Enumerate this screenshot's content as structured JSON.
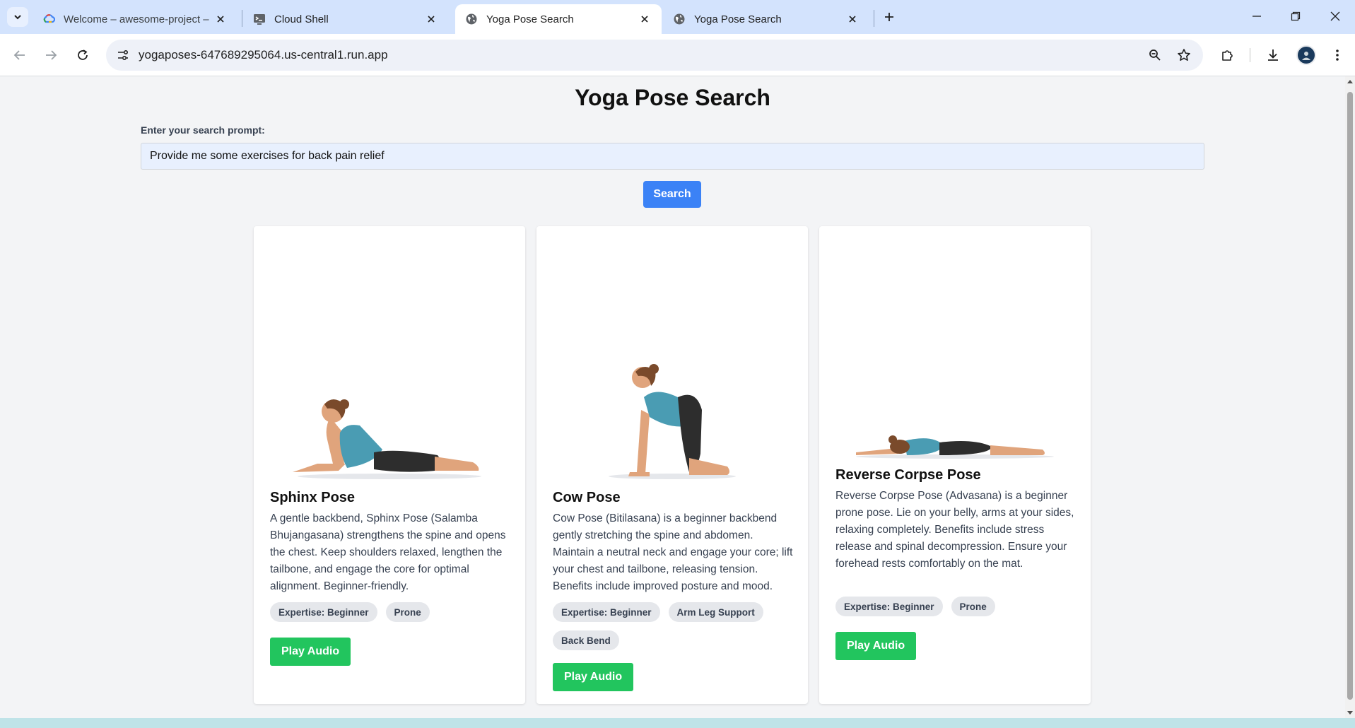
{
  "browser": {
    "tabs": [
      {
        "title": "Welcome – awesome-project –",
        "icon": "google-cloud-icon",
        "active": false
      },
      {
        "title": "Cloud Shell",
        "icon": "cloud-shell-icon",
        "active": false
      },
      {
        "title": "Yoga Pose Search",
        "icon": "globe-icon",
        "active": true
      },
      {
        "title": "Yoga Pose Search",
        "icon": "globe-icon",
        "active": false
      }
    ],
    "url": "yogaposes-647689295064.us-central1.run.app"
  },
  "page": {
    "title": "Yoga Pose Search",
    "search": {
      "label": "Enter your search prompt:",
      "value": "Provide me some exercises for back pain relief",
      "button_label": "Search"
    },
    "cards": [
      {
        "title": "Sphinx Pose",
        "description": "A gentle backbend, Sphinx Pose (Salamba Bhujangasana) strengthens the spine and opens the chest. Keep shoulders relaxed, lengthen the tailbone, and engage the core for optimal alignment. Beginner-friendly.",
        "tags": [
          "Expertise: Beginner",
          "Prone"
        ],
        "button_label": "Play Audio"
      },
      {
        "title": "Cow Pose",
        "description": "Cow Pose (Bitilasana) is a beginner backbend gently stretching the spine and abdomen. Maintain a neutral neck and engage your core; lift your chest and tailbone, releasing tension. Benefits include improved posture and mood.",
        "tags": [
          "Expertise: Beginner",
          "Arm Leg Support",
          "Back Bend"
        ],
        "button_label": "Play Audio"
      },
      {
        "title": "Reverse Corpse Pose",
        "description": "Reverse Corpse Pose (Advasana) is a beginner prone pose. Lie on your belly, arms at your sides, relaxing completely. Benefits include stress release and spinal decompression. Ensure your forehead rests comfortably on the mat.",
        "tags": [
          "Expertise: Beginner",
          "Prone"
        ],
        "button_label": "Play Audio"
      }
    ]
  },
  "colors": {
    "primary_button": "#3b82f6",
    "play_button": "#22c55e",
    "tag_bg": "#e5e7eb",
    "tab_strip": "#d3e3fd"
  }
}
